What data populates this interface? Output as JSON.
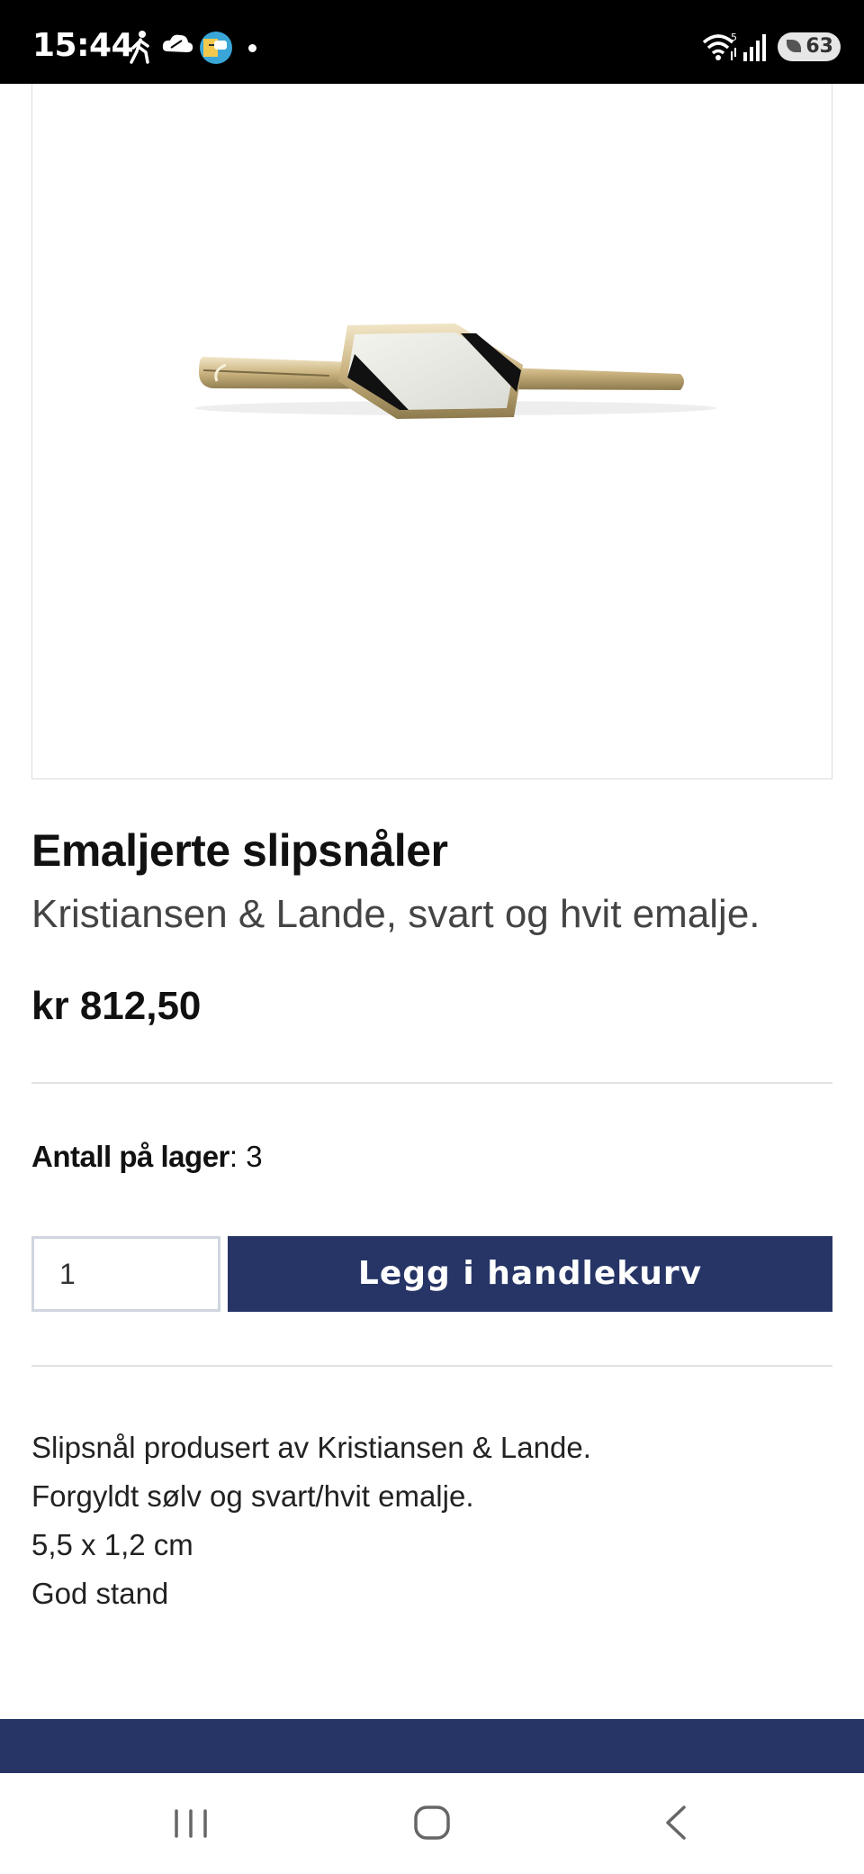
{
  "status_bar": {
    "time": "15:44",
    "battery": "63",
    "icons": [
      "walking-icon",
      "cloud-icon",
      "app-badge-icon",
      "dot-icon",
      "wifi-icon",
      "signal-icon"
    ]
  },
  "product": {
    "image_alt": "Emaljerte slipsnåler",
    "title": "Emaljerte slipsnåler",
    "subtitle": "Kristiansen & Lande, svart og hvit emalje.",
    "price": "kr 812,50",
    "stock_label": "Antall på lager",
    "stock_value": ": 3",
    "quantity_value": "1",
    "add_to_cart_label": "Legg i handlekurv",
    "description": [
      "Slipsnål produsert av Kristiansen & Lande.",
      "Forgyldt sølv og svart/hvit emalje.",
      "5,5 x 1,2 cm",
      "God stand"
    ]
  },
  "nav": {
    "icons": [
      "recents-icon",
      "home-icon",
      "back-icon"
    ]
  },
  "colors": {
    "accent": "#263566",
    "status_bar": "#000000"
  }
}
